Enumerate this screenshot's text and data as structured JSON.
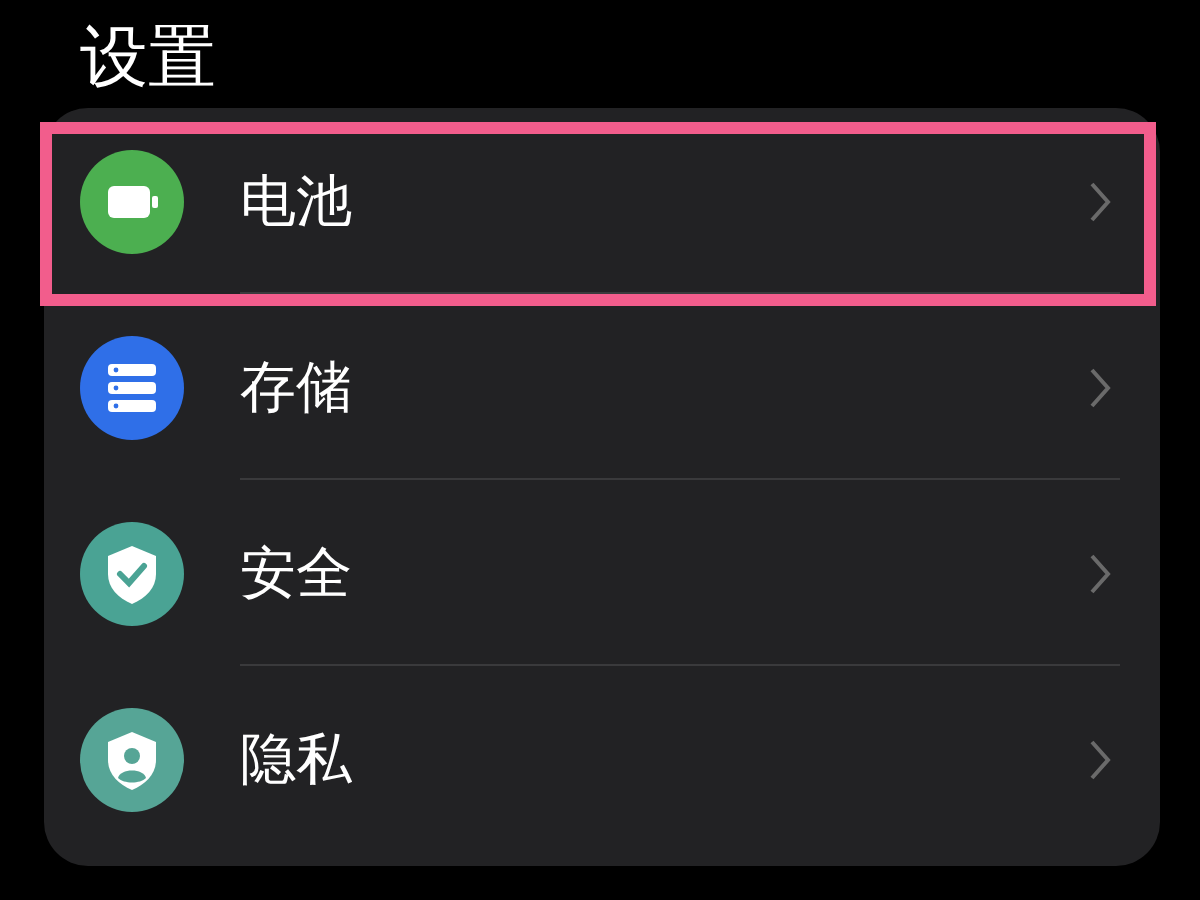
{
  "title": "设置",
  "items": [
    {
      "label": "电池",
      "kind": "battery",
      "color": "#4caf50",
      "highlighted": true
    },
    {
      "label": "存储",
      "kind": "storage",
      "color": "#2f6fe8",
      "highlighted": false
    },
    {
      "label": "安全",
      "kind": "security",
      "color": "#4aa394",
      "highlighted": false
    },
    {
      "label": "隐私",
      "kind": "privacy",
      "color": "#56a596",
      "highlighted": false
    }
  ]
}
